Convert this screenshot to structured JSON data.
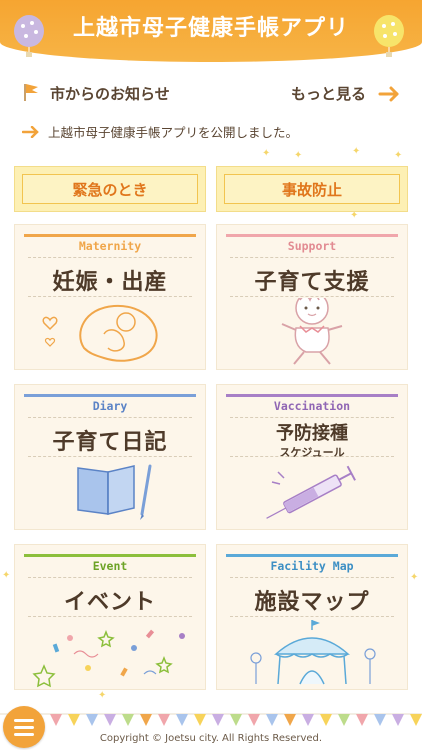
{
  "header": {
    "title": "上越市母子健康手帳アプリ"
  },
  "news": {
    "heading": "市からのお知らせ",
    "more_label": "もっと見る",
    "item": "上越市母子健康手帳アプリを公開しました。"
  },
  "quick": {
    "emergency": "緊急のとき",
    "accident": "事故防止"
  },
  "cards": [
    {
      "en": "Maternity",
      "ja": "妊娠・出産",
      "color": "#f0a64a"
    },
    {
      "en": "Support",
      "ja": "子育て支援",
      "color": "#f0a6ab"
    },
    {
      "en": "Diary",
      "ja": "子育て日記",
      "color": "#7a9fd8"
    },
    {
      "en": "Vaccination",
      "ja": "予防接種",
      "ja_sub": "スケジュール",
      "color": "#a77fc6"
    },
    {
      "en": "Event",
      "ja": "イベント",
      "color": "#8cbf3c"
    },
    {
      "en": "Facility Map",
      "ja": "施設マップ",
      "color": "#5aa9d8"
    }
  ],
  "footer": {
    "copyright": "Copyright © Joetsu city. All Rights Reserved."
  },
  "colors": {
    "accent": "#f6a531",
    "card_bg": "#fdf6ea",
    "button_bg": "#fdf0b4"
  },
  "icons": {
    "news_flag": "flag-icon",
    "more_arrow": "arrow-right-icon",
    "menu": "hamburger-icon"
  }
}
